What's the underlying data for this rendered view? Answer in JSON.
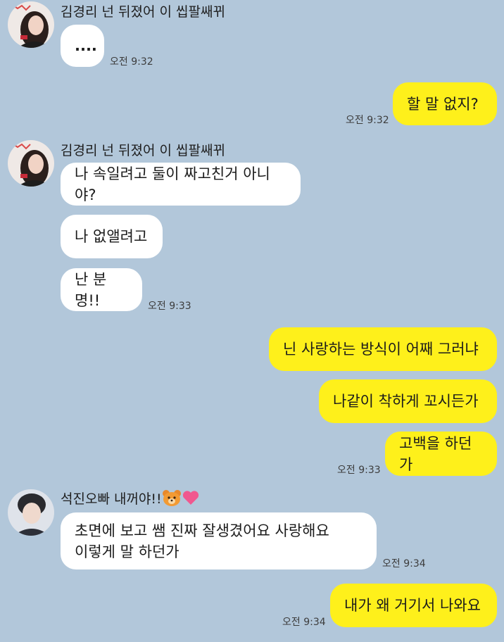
{
  "senders": {
    "s1": "김경리 넌 뒤졌어 이 씹팔쌔뀌",
    "s2": "석진오빠 내꺼야!!"
  },
  "messages": {
    "m1": "....",
    "m2": "할 말 없지?",
    "m3": "나 속일려고 둘이 짜고친거 아니야?",
    "m4": "나 없앨려고",
    "m5": "난 분명!!",
    "m6": "닌 사랑하는 방식이 어째 그러냐",
    "m7": "나같이 착하게 꼬시든가",
    "m8": "고백을 하던가",
    "m9": "초면에 보고 쌤 진짜 잘생겼어요 사랑해요\n이렇게 말 하던가",
    "m10": "내가 왜 거기서 나와요"
  },
  "times": {
    "t1": "오전 9:32",
    "t2": "오전 9:32",
    "t3": "오전 9:33",
    "t4": "오전 9:33",
    "t5": "오전 9:34",
    "t6": "오전 9:34"
  },
  "icons": [
    "bear-emoji-icon",
    "heart-icon"
  ],
  "colors": {
    "background": "#b2c7da",
    "incoming_bubble": "#ffffff",
    "outgoing_bubble": "#fef01b",
    "heart": "#f0588f"
  }
}
